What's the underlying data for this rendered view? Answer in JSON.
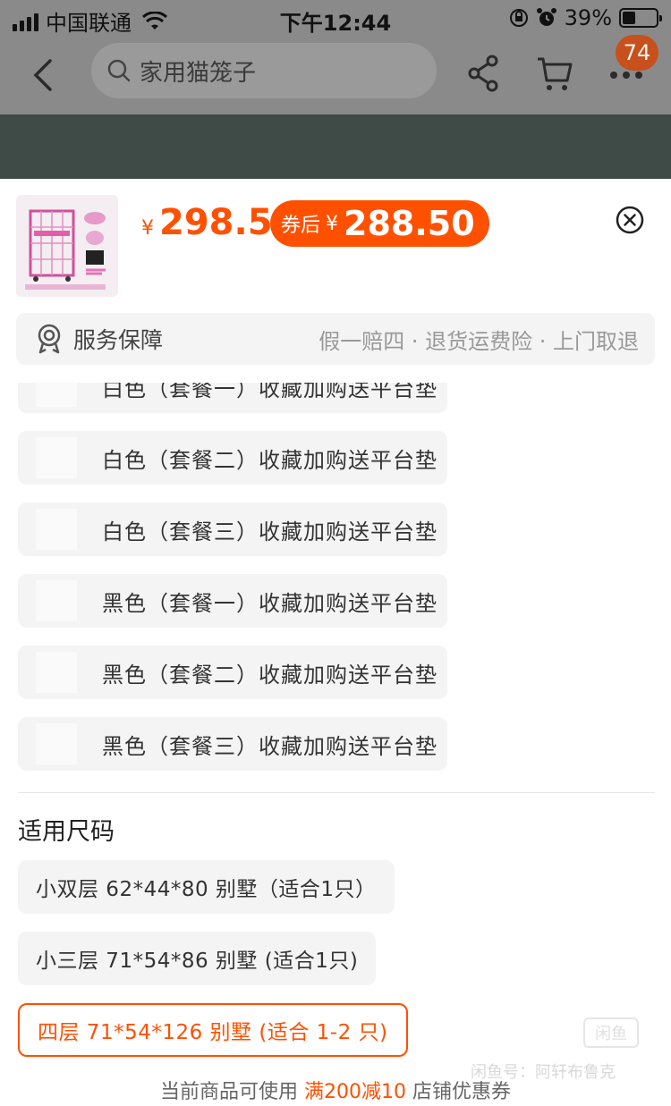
{
  "status_bar": {
    "carrier": "中国联通",
    "time": "下午12:44",
    "battery": "39%",
    "battery_level": 0.39
  },
  "nav": {
    "search_text": "家用猫笼子",
    "badge": "74"
  },
  "sheet": {
    "price": "298.5",
    "currency": "¥",
    "coupon_label": "券后",
    "coupon_price": "288.50",
    "service_title": "服务保障",
    "service_desc": "假一赔四 · 退货运费险 · 上门取退",
    "options": [
      "白色（套餐一）收藏加购送平台垫",
      "白色（套餐二）收藏加购送平台垫",
      "白色（套餐三）收藏加购送平台垫",
      "黑色（套餐一）收藏加购送平台垫",
      "黑色（套餐二）收藏加购送平台垫",
      "黑色（套餐三）收藏加购送平台垫"
    ],
    "size_title": "适用尺码",
    "sizes": [
      "小双层 62*44*80 别墅（适合1只）",
      "小三层 71*54*86 别墅 (适合1只)",
      "四层 71*54*126 别墅 (适合 1-2 只)"
    ],
    "footer_pre": "当前商品可使用",
    "footer_hl": "满200减10",
    "footer_post": "店铺优惠券",
    "watermark": "闲鱼号：阿轩布鲁克"
  },
  "colors": {
    "accent": "#ff5000",
    "overlay": "#8a8a8a",
    "band": "#3f4b46"
  }
}
